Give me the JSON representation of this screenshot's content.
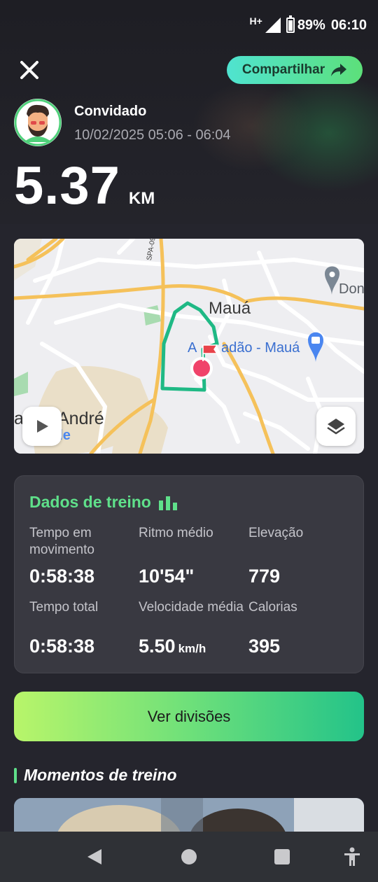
{
  "status_bar": {
    "network": "H+",
    "battery": "89%",
    "time": "06:10"
  },
  "header": {
    "share_label": "Compartilhar"
  },
  "user": {
    "name": "Convidado",
    "datetime": "10/02/2025 05:06 - 06:04"
  },
  "activity": {
    "distance": "5.37",
    "distance_unit": "KM"
  },
  "map": {
    "city_label": "Mauá",
    "place_label": "Atacadão - Mauá",
    "place_label_prefix": "A",
    "place_label_rest": "adão - Mauá",
    "poi_label": "Don",
    "area_label": "André",
    "area_prefix": "a",
    "road_label": "SPA-096/21",
    "google_partial": "gle"
  },
  "stats": {
    "title": "Dados de treino",
    "moving_time_label": "Tempo em movimento",
    "moving_time": "0:58:38",
    "avg_pace_label": "Ritmo médio",
    "avg_pace": "10'54\"",
    "elevation_label": "Elevação",
    "elevation": "779",
    "total_time_label": "Tempo total",
    "total_time": "0:58:38",
    "avg_speed_label": "Velocidade média",
    "avg_speed": "5.50",
    "avg_speed_unit": "km/h",
    "calories_label": "Calorias",
    "calories": "395"
  },
  "actions": {
    "divisions_label": "Ver divisões"
  },
  "moments": {
    "title": "Momentos de treino"
  },
  "colors": {
    "accent_green": "#5fe08a",
    "route": "#1fb985",
    "background": "#25252d",
    "card": "#393941"
  }
}
